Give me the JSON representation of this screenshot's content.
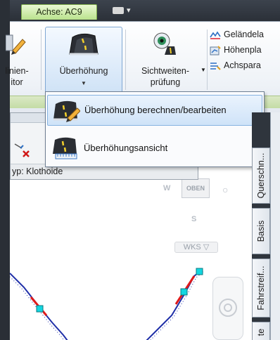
{
  "window": {
    "context_tab_label": "Achse: AC9"
  },
  "ribbon": {
    "partial_button": {
      "line1": "linien-",
      "line2": "itor"
    },
    "ueberhoehung_button": {
      "label": "Überhöhung"
    },
    "sichtweiten_button": {
      "line1": "Sichtweiten-",
      "line2": "prüfung"
    },
    "small_items": [
      {
        "label": "Geländela",
        "icon": "terrain-icon"
      },
      {
        "label": "Höhenpla",
        "icon": "elevation-plan-icon"
      },
      {
        "label": "Achspara",
        "icon": "alignment-params-icon"
      }
    ]
  },
  "dropdown_menu": {
    "items": [
      {
        "label": "Überhöhung berechnen/bearbeiten",
        "icon": "superelevation-edit-icon",
        "highlighted": true
      },
      {
        "label": "Überhöhungsansicht",
        "icon": "superelevation-view-icon",
        "highlighted": false
      }
    ]
  },
  "palette": {
    "row_text": "yp: Klothoide"
  },
  "viewcube": {
    "west": "W",
    "south": "S",
    "top_face": "OBEN",
    "ucs_label": "WKS"
  },
  "side_tabs": [
    {
      "label": "Querschn..."
    },
    {
      "label": "Basis"
    },
    {
      "label": "Fahrstreif..."
    },
    {
      "label": "te"
    }
  ],
  "colors": {
    "context_tab": "#b9e28c",
    "alignment_line": "#1f2fa8",
    "superelevation_segment": "#e01a1a",
    "grip": "#12d6e0"
  }
}
